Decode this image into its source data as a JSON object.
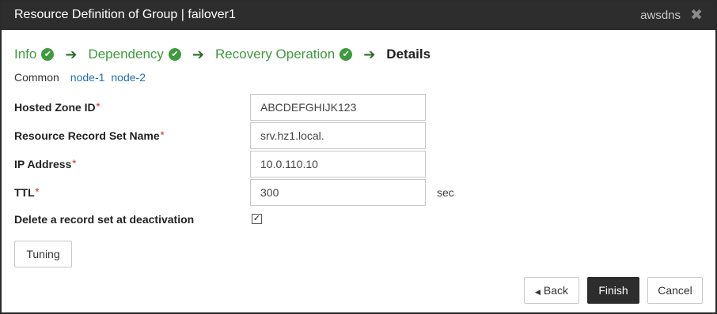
{
  "dialog": {
    "title": "Resource Definition of Group | failover1",
    "resource_name": "awsdns",
    "close_glyph": "✖"
  },
  "steps": [
    {
      "label": "Info",
      "done": true
    },
    {
      "label": "Dependency",
      "done": true
    },
    {
      "label": "Recovery Operation",
      "done": true
    },
    {
      "label": "Details",
      "current": true
    }
  ],
  "step_icons": {
    "check": "✔",
    "arrow": "➔"
  },
  "subtabs": [
    {
      "label": "Common",
      "active": true
    },
    {
      "label": "node-1"
    },
    {
      "label": "node-2"
    }
  ],
  "form": {
    "hosted_zone": {
      "label": "Hosted Zone ID",
      "required_mark": "*",
      "value": "ABCDEFGHIJK123"
    },
    "record_set": {
      "label": "Resource Record Set Name",
      "required_mark": "*",
      "value": "srv.hz1.local."
    },
    "ip_address": {
      "label": "IP Address",
      "required_mark": "*",
      "value": "10.0.110.10"
    },
    "ttl": {
      "label": "TTL",
      "required_mark": "*",
      "value": "300",
      "unit": "sec"
    },
    "delete_record": {
      "label": "Delete a record set at deactivation",
      "checked": true,
      "check_glyph": "✓"
    }
  },
  "buttons": {
    "tuning": "Tuning",
    "back_icon": "◀",
    "back": "Back",
    "finish": "Finish",
    "cancel": "Cancel"
  },
  "colors": {
    "titlebar": "#2d2d2d",
    "step_done": "#3d9a3d",
    "link": "#1e6fb8",
    "required": "#d9534f",
    "primary_button": "#2d2d2d"
  }
}
